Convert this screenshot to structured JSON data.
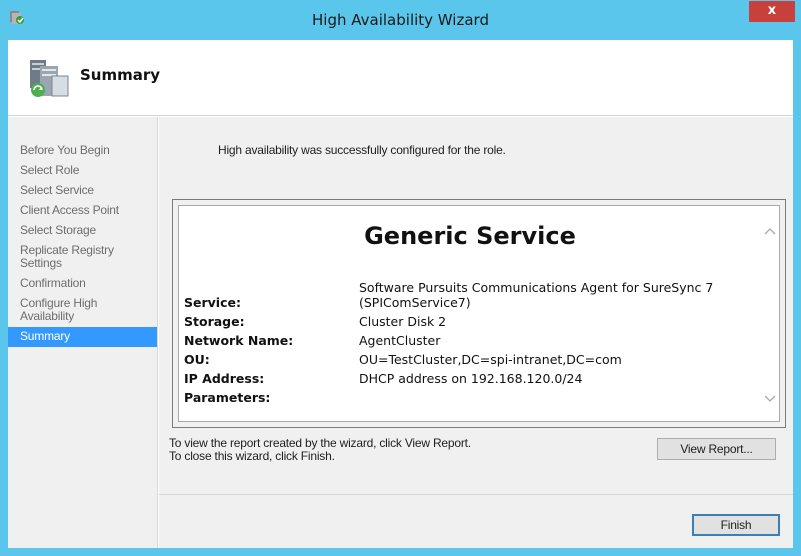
{
  "window": {
    "title": "High Availability Wizard",
    "close_glyph": "x"
  },
  "header": {
    "title": "Summary"
  },
  "steps": [
    {
      "label": "Before You Begin"
    },
    {
      "label": "Select Role"
    },
    {
      "label": "Select Service"
    },
    {
      "label": "Client Access Point"
    },
    {
      "label": "Select Storage"
    },
    {
      "label": "Replicate Registry Settings"
    },
    {
      "label": "Confirmation"
    },
    {
      "label": "Configure High Availability"
    },
    {
      "label": "Summary",
      "active": true
    }
  ],
  "content": {
    "success_message": "High availability was successfully configured for the role.",
    "report": {
      "title": "Generic Service",
      "rows": [
        {
          "key": "Service:",
          "value": "Software Pursuits Communications Agent for SureSync 7 (SPIComService7)"
        },
        {
          "key": "Storage:",
          "value": "Cluster Disk 2"
        },
        {
          "key": "Network Name:",
          "value": "AgentCluster"
        },
        {
          "key": "OU:",
          "value": "OU=TestCluster,DC=spi-intranet,DC=com"
        },
        {
          "key": "IP Address:",
          "value": "DHCP address on 192.168.120.0/24"
        },
        {
          "key": "Parameters:",
          "value": ""
        }
      ]
    },
    "info_line1": "To view the report created by the wizard, click View Report.",
    "info_line2": "To close this wizard, click Finish.",
    "view_report_label": "View Report...",
    "finish_label": "Finish"
  },
  "colors": {
    "titlebar": "#5bc6ec",
    "close": "#c8403b",
    "selection": "#3399ff"
  }
}
